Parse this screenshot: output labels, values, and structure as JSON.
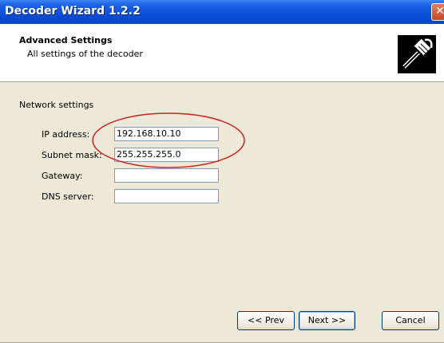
{
  "window": {
    "title": "Decoder Wizard 1.2.2",
    "close_glyph": "✕"
  },
  "header": {
    "title": "Advanced Settings",
    "subtitle": "All settings of the decoder",
    "icon": "network-cable-icon"
  },
  "network": {
    "section_label": "Network settings",
    "fields": [
      {
        "label": "IP address:",
        "value": "192.168.10.10"
      },
      {
        "label": "Subnet mask:",
        "value": "255.255.255.0"
      },
      {
        "label": "Gateway:",
        "value": ""
      },
      {
        "label": "DNS server:",
        "value": ""
      }
    ]
  },
  "buttons": {
    "prev": "<< Prev",
    "next": "Next >>",
    "cancel": "Cancel"
  },
  "colors": {
    "highlight_oval": "#d42020",
    "titlebar": "#0a4fd6"
  }
}
